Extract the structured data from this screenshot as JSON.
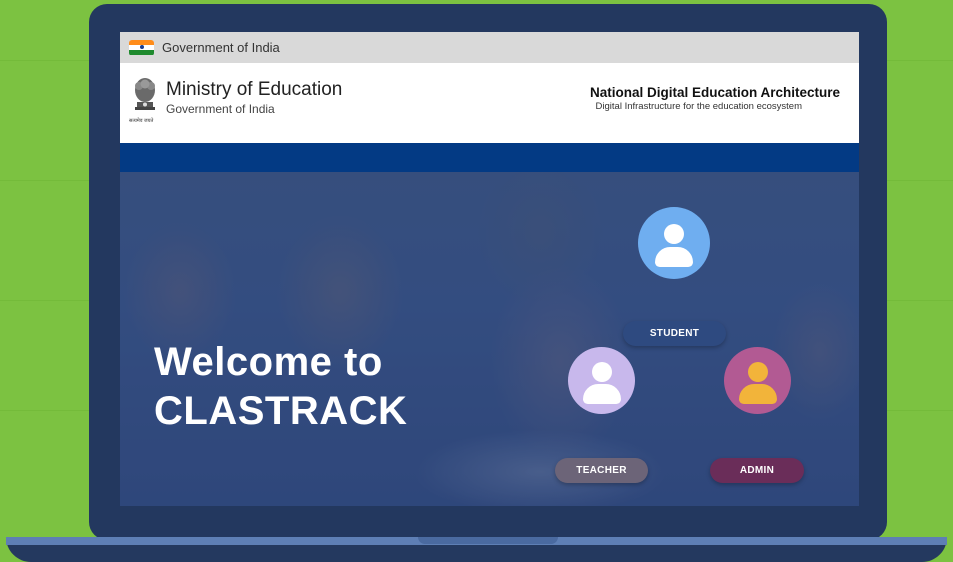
{
  "gov_bar": {
    "label": "Government of India"
  },
  "header": {
    "ministry_title": "Ministry of Education",
    "ministry_subtitle": "Government of India",
    "emblem_caption": "सत्यमेव जयते",
    "nde_title": "National Digital Education Architecture",
    "nde_subtitle": "Digital Infrastructure for the education ecosystem"
  },
  "hero": {
    "welcome_line1": "Welcome to",
    "welcome_line2": "CLASTRACK"
  },
  "roles": {
    "student": {
      "label": "STUDENT",
      "icon": "student-avatar-icon",
      "icon_color": "#6faef0",
      "label_color": "#2e4a80"
    },
    "teacher": {
      "label": "TEACHER",
      "icon": "teacher-avatar-icon",
      "icon_color": "#c8b8ec",
      "label_color": "#6c6478"
    },
    "admin": {
      "label": "ADMIN",
      "icon": "admin-avatar-icon",
      "icon_color": "#b25a93",
      "label_color": "#6a2d59"
    }
  },
  "colors": {
    "background": "#7cc241",
    "laptop": "#23385f",
    "gov_blue": "#033a84"
  }
}
